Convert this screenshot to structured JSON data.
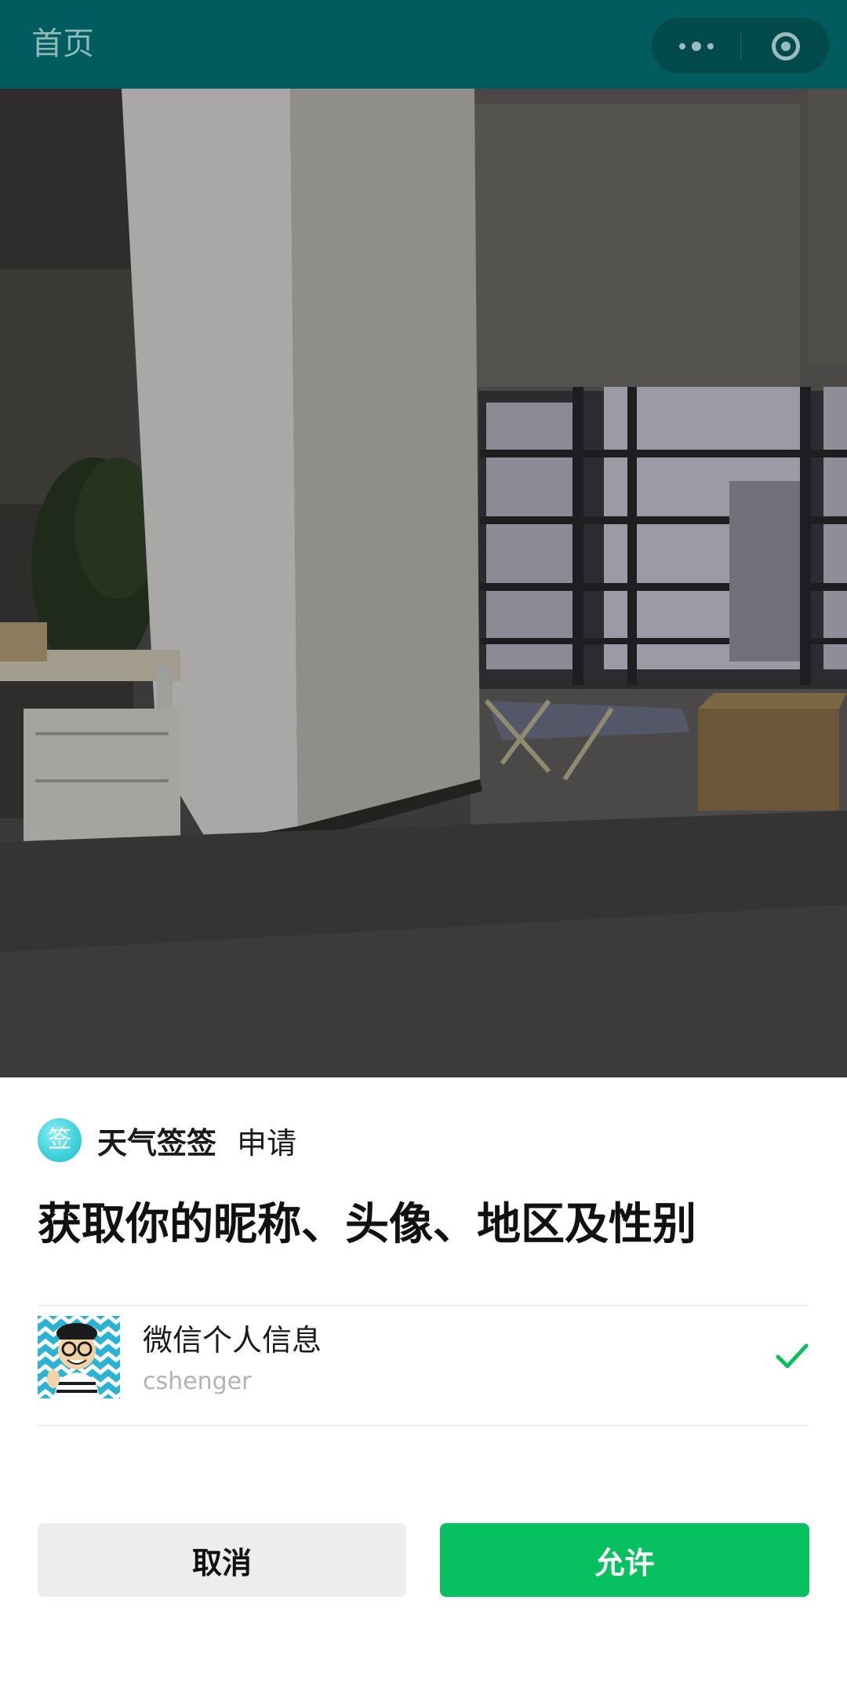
{
  "navbar": {
    "title": "首页",
    "more_icon": "more-dots-icon",
    "close_icon": "close-circle-icon",
    "background_color": "#005c5f"
  },
  "auth_sheet": {
    "app_logo_text": "签",
    "app_name": "天气签签",
    "apply_text": "申请",
    "request_title": "获取你的昵称、头像、地区及性别",
    "info_item": {
      "label": "微信个人信息",
      "username": "cshenger",
      "selected": true,
      "check_icon": "check-icon"
    },
    "cancel_label": "取消",
    "allow_label": "允许",
    "allow_color": "#07c160"
  }
}
